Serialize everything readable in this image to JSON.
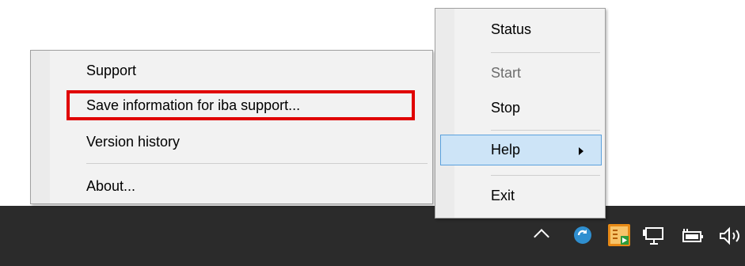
{
  "submenu": {
    "items": [
      {
        "label": "Support"
      },
      {
        "label": "Save information for iba support..."
      },
      {
        "label": "Version history"
      },
      {
        "label": "About..."
      }
    ]
  },
  "main_menu": {
    "items": [
      {
        "label": "Status",
        "enabled": true
      },
      {
        "label": "Start",
        "enabled": false
      },
      {
        "label": "Stop",
        "enabled": true
      },
      {
        "label": "Help",
        "enabled": true,
        "has_submenu": true,
        "hovered": true
      },
      {
        "label": "Exit",
        "enabled": true
      }
    ]
  },
  "highlight_color": "#e00000",
  "tray": {
    "icons": [
      "chevron-up-icon",
      "sync-icon",
      "iba-app-icon",
      "network-icon",
      "battery-icon",
      "volume-icon"
    ]
  }
}
